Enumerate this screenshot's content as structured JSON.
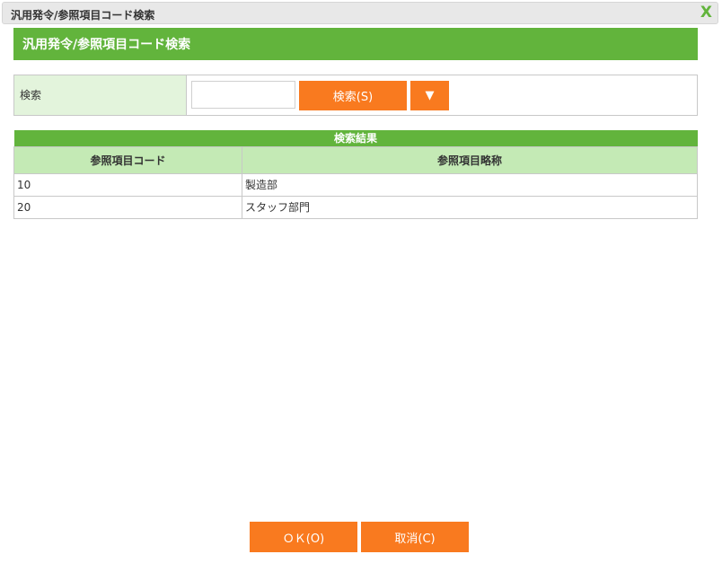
{
  "window": {
    "title": "汎用発令/参照項目コード検索",
    "close_icon": "X"
  },
  "header": {
    "title": "汎用発令/参照項目コード検索"
  },
  "search": {
    "label": "検索",
    "input_value": "",
    "button": "検索(S)",
    "dropdown": "▼"
  },
  "results": {
    "caption": "検索結果",
    "columns": [
      "参照項目コード",
      "参照項目略称"
    ],
    "rows": [
      [
        "10",
        "製造部"
      ],
      [
        "20",
        "スタッフ部門"
      ]
    ]
  },
  "footer": {
    "ok": "ＯＫ(O)",
    "cancel": "取消(C)"
  },
  "colors": {
    "green": "#62b43c",
    "orange": "#f97a1f"
  }
}
